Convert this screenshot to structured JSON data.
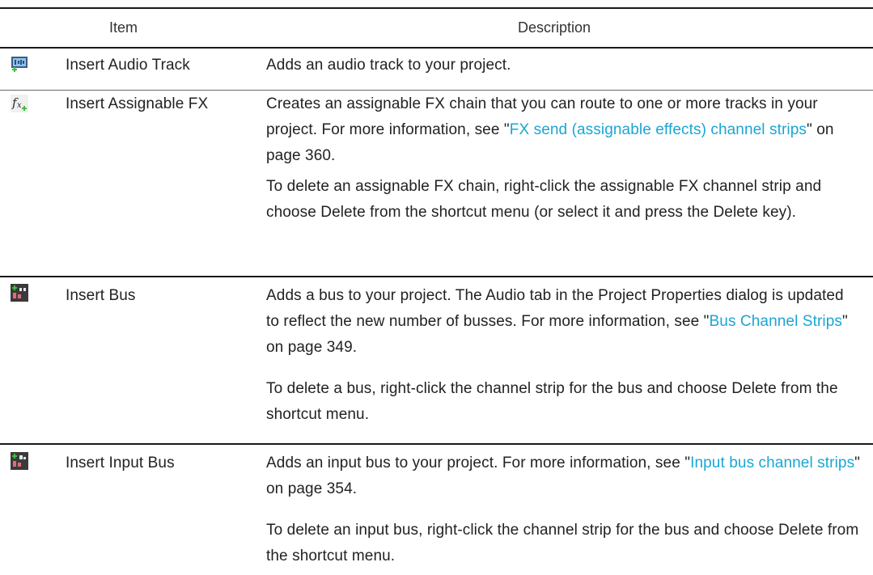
{
  "header": {
    "item": "Item",
    "description": "Description"
  },
  "rows": [
    {
      "name": "Insert Audio Track",
      "icon": "audio-track-icon",
      "paragraphs": [
        {
          "text": "Adds an audio track to your project."
        }
      ]
    },
    {
      "name": "Insert Assignable FX",
      "icon": "assignable-fx-icon",
      "paragraphs": [
        {
          "before": "Creates an assignable FX chain that you can route to one or more tracks in your project. For more information, see \"",
          "link": "FX send (assignable effects) channel strips",
          "after": "\" on page 360."
        },
        {
          "text": "To delete an assignable FX chain, right-click the assignable FX channel strip and choose Delete from the shortcut menu (or select it and press the Delete key)."
        }
      ]
    },
    {
      "name": "Insert Bus",
      "icon": "insert-bus-icon",
      "paragraphs": [
        {
          "before": "Adds a bus to your project. The Audio tab in the Project Properties dialog is updated to reflect the new number of busses. For more information, see \"",
          "link": "Bus Channel Strips",
          "after": "\" on page 349."
        },
        {
          "text": "To delete a bus, right-click the channel strip for the bus and choose Delete from the shortcut menu."
        }
      ]
    },
    {
      "name": "Insert Input Bus",
      "icon": "insert-input-bus-icon",
      "paragraphs": [
        {
          "before": "Adds an input bus to your project. For more information, see \"",
          "link": "Input bus channel strips",
          "after": "\" on page 354."
        },
        {
          "text": "To delete an input bus, right-click the channel strip for the bus and choose Delete from the shortcut menu."
        }
      ]
    }
  ]
}
